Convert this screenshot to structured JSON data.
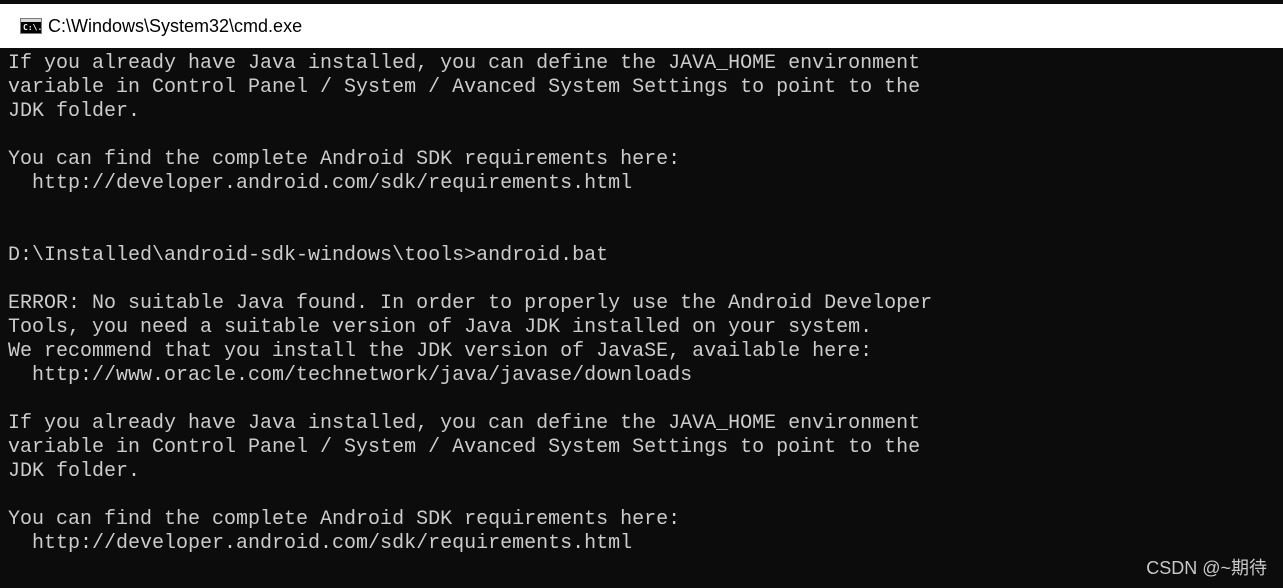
{
  "window": {
    "title": "C:\\Windows\\System32\\cmd.exe",
    "icon": "cmd-icon",
    "icon_label": "C:\\."
  },
  "console": {
    "lines": [
      "If you already have Java installed, you can define the JAVA_HOME environment",
      "variable in Control Panel / System / Avanced System Settings to point to the",
      "JDK folder.",
      "",
      "You can find the complete Android SDK requirements here:",
      "  http://developer.android.com/sdk/requirements.html",
      "",
      "",
      "D:\\Installed\\android-sdk-windows\\tools>android.bat",
      "",
      "ERROR: No suitable Java found. In order to properly use the Android Developer",
      "Tools, you need a suitable version of Java JDK installed on your system.",
      "We recommend that you install the JDK version of JavaSE, available here:",
      "  http://www.oracle.com/technetwork/java/javase/downloads",
      "",
      "If you already have Java installed, you can define the JAVA_HOME environment",
      "variable in Control Panel / System / Avanced System Settings to point to the",
      "JDK folder.",
      "",
      "You can find the complete Android SDK requirements here:",
      "  http://developer.android.com/sdk/requirements.html"
    ]
  },
  "watermark": "CSDN @~期待",
  "colors": {
    "console_background": "#0c0c0c",
    "console_text": "#cccccc",
    "titlebar_background": "#ffffff"
  }
}
